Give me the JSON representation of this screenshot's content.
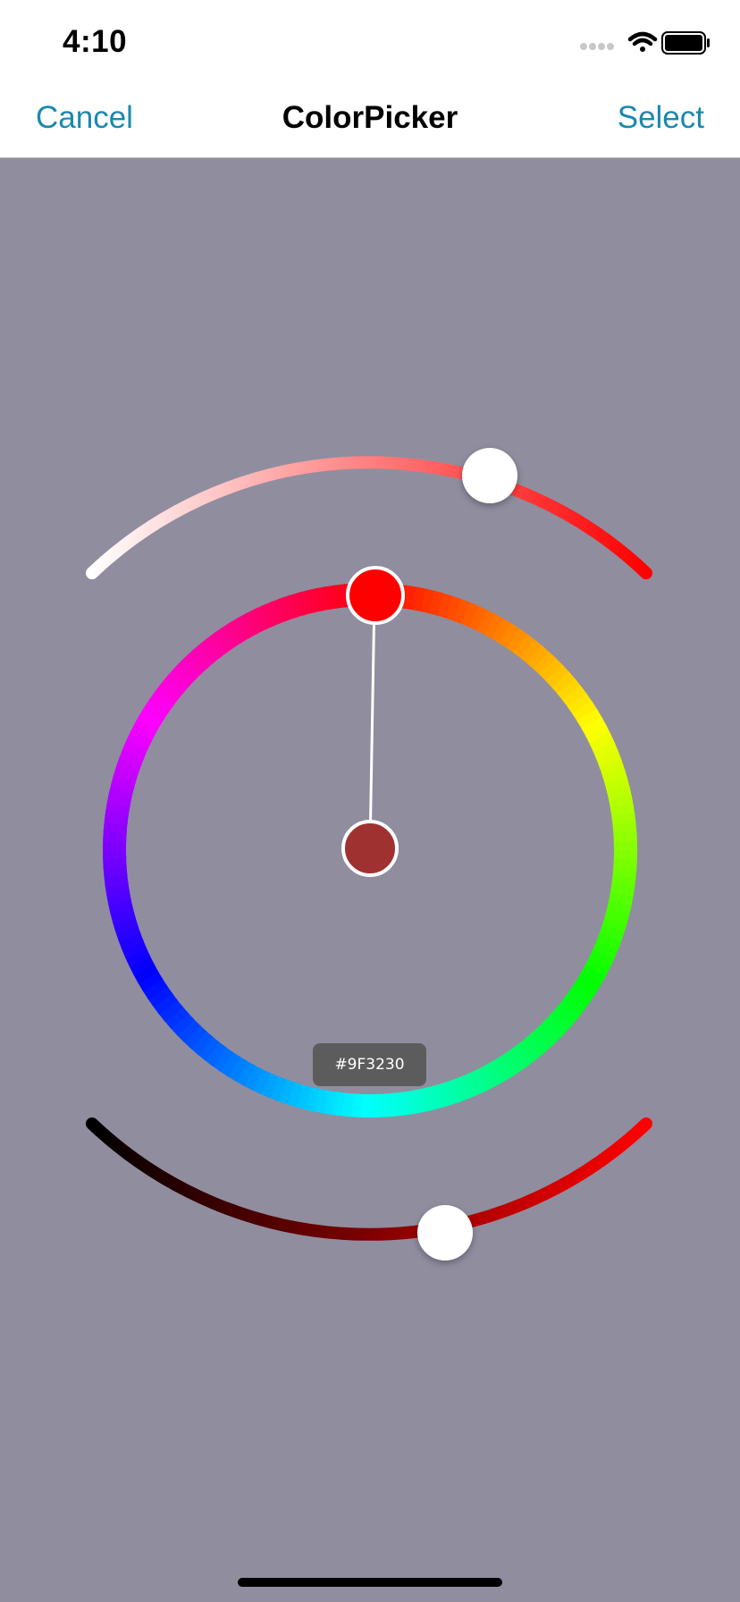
{
  "status_bar": {
    "time": "4:10",
    "icons": [
      "signal-dots-icon",
      "wifi-icon",
      "battery-icon"
    ]
  },
  "nav": {
    "cancel_label": "Cancel",
    "title": "ColorPicker",
    "select_label": "Select"
  },
  "picker": {
    "selected_hex": "#9F3230",
    "selected_color": "#9F3230",
    "hue_color": "#FF0000",
    "saturation_value": 0.78,
    "brightness_value": 0.62,
    "hue_degrees": 0
  },
  "colors": {
    "accent": "#1A89B0",
    "background": "#908D9F",
    "label_background": "#5C5C5C"
  }
}
